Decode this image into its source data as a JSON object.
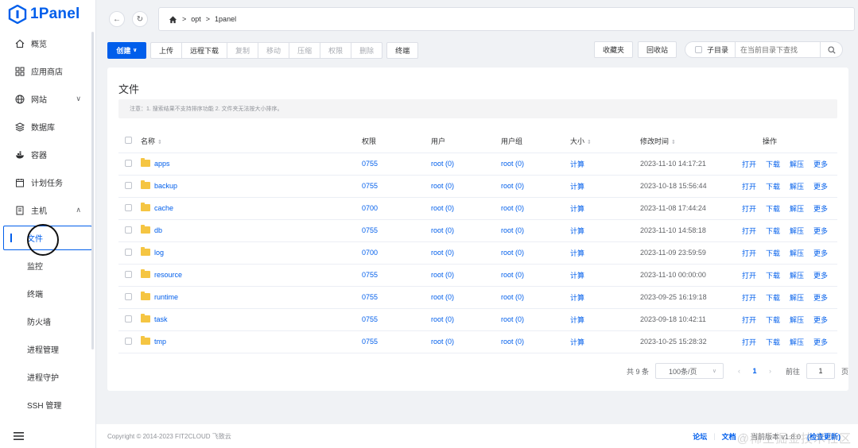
{
  "app": {
    "logo_text": "1Panel"
  },
  "sidebar": {
    "items": [
      {
        "label": "概览",
        "icon": "home-icon"
      },
      {
        "label": "应用商店",
        "icon": "grid-icon"
      },
      {
        "label": "网站",
        "icon": "globe-icon",
        "chevron": "∨"
      },
      {
        "label": "数据库",
        "icon": "layers-icon"
      },
      {
        "label": "容器",
        "icon": "whale-icon"
      },
      {
        "label": "计划任务",
        "icon": "calendar-icon"
      },
      {
        "label": "主机",
        "icon": "server-icon",
        "chevron": "∧"
      }
    ],
    "subitems": [
      "文件",
      "监控",
      "终端",
      "防火墙",
      "进程管理",
      "进程守护",
      "SSH 管理"
    ]
  },
  "topbar": {
    "path": [
      "opt",
      "1panel"
    ],
    "sep": ">"
  },
  "toolbar": {
    "create": "创建",
    "group1": [
      "上传",
      "远程下载",
      "复制",
      "移动",
      "压缩",
      "权限",
      "删除"
    ],
    "terminal": "终端",
    "favorites": "收藏夹",
    "recycle": "回收站",
    "subdir": "子目录",
    "search_placeholder": "在当前目录下查找"
  },
  "card": {
    "title": "文件",
    "notice": "注意：1. 搜索结果不支持排序功能 2. 文件夹无法按大小排序。",
    "columns": [
      "名称",
      "权限",
      "用户",
      "用户组",
      "大小",
      "修改时间",
      "操作"
    ],
    "rows": [
      {
        "name": "apps",
        "perm": "0755",
        "user": "root (0)",
        "group": "root (0)",
        "size": "计算",
        "time": "2023-11-10 14:17:21"
      },
      {
        "name": "backup",
        "perm": "0755",
        "user": "root (0)",
        "group": "root (0)",
        "size": "计算",
        "time": "2023-10-18 15:56:44"
      },
      {
        "name": "cache",
        "perm": "0700",
        "user": "root (0)",
        "group": "root (0)",
        "size": "计算",
        "time": "2023-11-08 17:44:24"
      },
      {
        "name": "db",
        "perm": "0755",
        "user": "root (0)",
        "group": "root (0)",
        "size": "计算",
        "time": "2023-11-10 14:58:18"
      },
      {
        "name": "log",
        "perm": "0700",
        "user": "root (0)",
        "group": "root (0)",
        "size": "计算",
        "time": "2023-11-09 23:59:59"
      },
      {
        "name": "resource",
        "perm": "0755",
        "user": "root (0)",
        "group": "root (0)",
        "size": "计算",
        "time": "2023-11-10 00:00:00"
      },
      {
        "name": "runtime",
        "perm": "0755",
        "user": "root (0)",
        "group": "root (0)",
        "size": "计算",
        "time": "2023-09-25 16:19:18"
      },
      {
        "name": "task",
        "perm": "0755",
        "user": "root (0)",
        "group": "root (0)",
        "size": "计算",
        "time": "2023-09-18 10:42:11"
      },
      {
        "name": "tmp",
        "perm": "0755",
        "user": "root (0)",
        "group": "root (0)",
        "size": "计算",
        "time": "2023-10-25 15:28:32"
      }
    ],
    "ops": [
      "打开",
      "下载",
      "解压",
      "更多"
    ]
  },
  "pager": {
    "total": "共 9 条",
    "page_size": "100条/页",
    "current": "1",
    "goto_label": "前往",
    "goto_value": "1",
    "page_unit": "页"
  },
  "footer": {
    "copyright": "Copyright © 2014-2023 FIT2CLOUD 飞致云",
    "forum": "论坛",
    "docs": "文档",
    "version": "当前版本 v1.8.0",
    "update": "(检查更新)",
    "watermark": "@稀土掘金技术社区"
  }
}
